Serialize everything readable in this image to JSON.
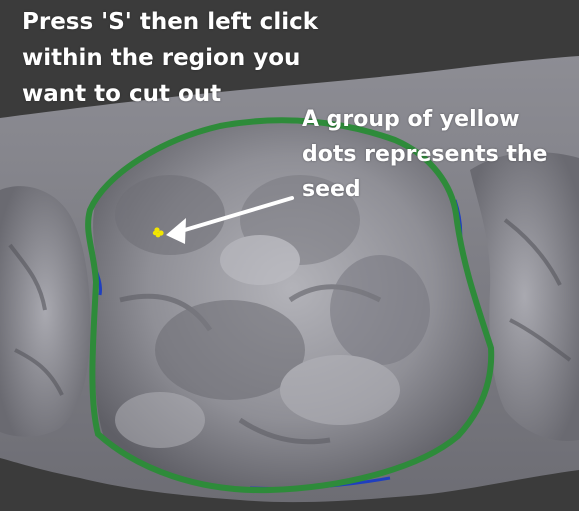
{
  "instruction": {
    "lines": [
      "Press 'S' then left click",
      "within the region you",
      "want to cut out"
    ]
  },
  "annotation": {
    "lines": [
      "A group of yellow",
      "dots represents the",
      "seed"
    ]
  },
  "colors": {
    "background": "#3b3b3b",
    "mesh": "#9a9aa0",
    "boundary": "#2e8b3a",
    "boundary_inner": "#1f3fbf",
    "seed": "#f2e600",
    "text": "#ffffff"
  },
  "icons": {
    "seed_marker": "yellow-dots-icon",
    "arrow": "arrow-left-icon"
  }
}
